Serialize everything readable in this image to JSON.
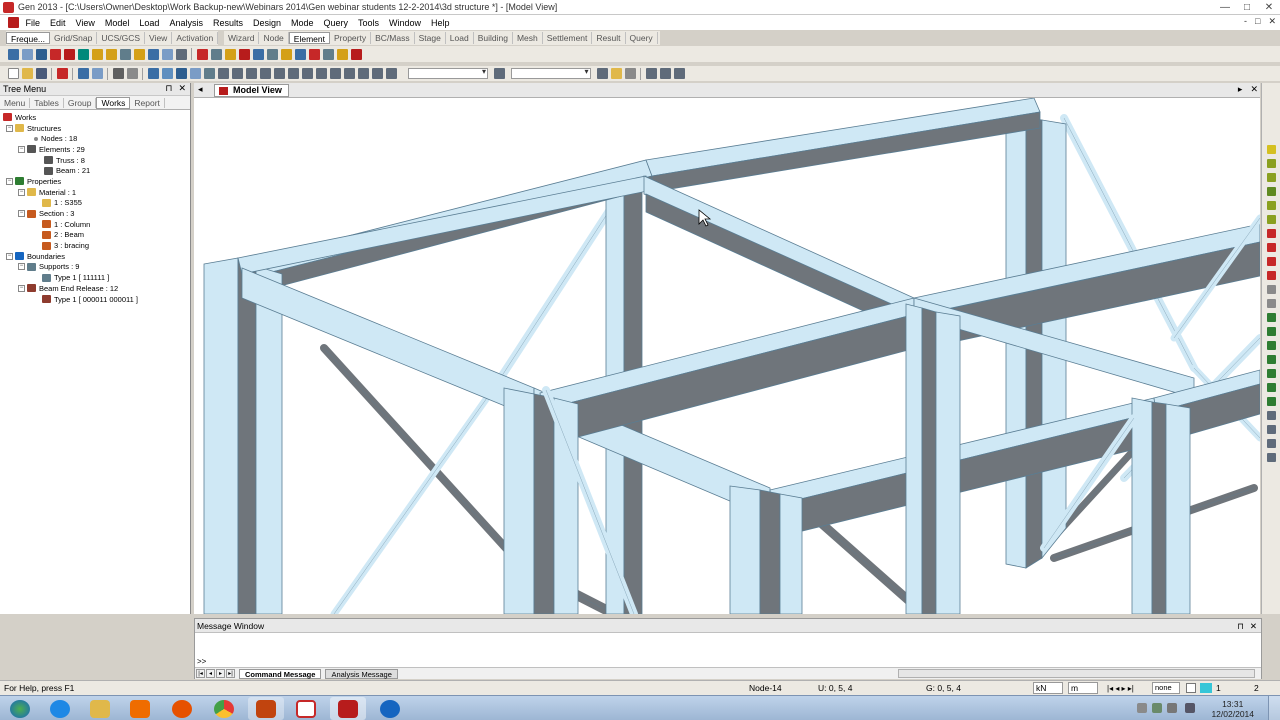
{
  "window": {
    "title": "Gen 2013 - [C:\\Users\\Owner\\Desktop\\Work Backup-new\\Webinars 2014\\Gen webinar students 12-2-2014\\3d structure *] - [Model View]",
    "minimize": "—",
    "maximize": "□",
    "close": "✕"
  },
  "menubar": {
    "items": [
      "File",
      "Edit",
      "View",
      "Model",
      "Load",
      "Analysis",
      "Results",
      "Design",
      "Mode",
      "Query",
      "Tools",
      "Window",
      "Help"
    ],
    "mdi_controls": [
      "-",
      "□",
      "✕"
    ]
  },
  "ribbon": {
    "left_tabs": [
      "Freque...",
      "Grid/Snap",
      "UCS/GCS",
      "View C...",
      "Activation"
    ],
    "main_tabs": [
      "Wizard",
      "Node",
      "Element",
      "Property",
      "BC/Mass",
      "Stage",
      "Load",
      "Building",
      "Mesh",
      "Settlement",
      "Result",
      "Query"
    ],
    "active_main_tab": "Element"
  },
  "tree_panel": {
    "title": "Tree Menu",
    "tabs": [
      "Menu",
      "Tables",
      "Group",
      "Works",
      "Report"
    ],
    "active_tab": "Works",
    "nodes": [
      {
        "label": "Works"
      },
      {
        "label": "Structures"
      },
      {
        "label": "Nodes : 18"
      },
      {
        "label": "Elements : 29"
      },
      {
        "label": "Truss : 8"
      },
      {
        "label": "Beam : 21"
      },
      {
        "label": "Properties"
      },
      {
        "label": "Material : 1"
      },
      {
        "label": "1 : S355"
      },
      {
        "label": "Section : 3"
      },
      {
        "label": "1 : Column"
      },
      {
        "label": "2 : Beam"
      },
      {
        "label": "3 : bracing"
      },
      {
        "label": "Boundaries"
      },
      {
        "label": "Supports : 9"
      },
      {
        "label": "Type 1 [ 111111 ]"
      },
      {
        "label": "Beam End Release : 12"
      },
      {
        "label": "Type 1 [ 000011 000011 ]"
      }
    ]
  },
  "model_view": {
    "tab_label": "Model View",
    "colors": {
      "member_light": "#cfe8f5",
      "member_dark": "#6f757b",
      "outline": "#5a7d93",
      "background": "#ffffff"
    }
  },
  "message_window": {
    "title": "Message Window",
    "prompt": ">>",
    "tabs": [
      "Command Message",
      "Analysis Message"
    ],
    "active_tab": "Command Message"
  },
  "statusbar": {
    "help": "For Help, press F1",
    "node": "Node-14",
    "u_coord": "U: 0, 5, 4",
    "g_coord": "G: 0, 5, 4",
    "force_unit": "kN",
    "length_unit": "m",
    "view_mode": "none",
    "page_current": "1",
    "page_total": "2"
  },
  "taskbar": {
    "time": "13:31",
    "date": "12/02/2014"
  }
}
